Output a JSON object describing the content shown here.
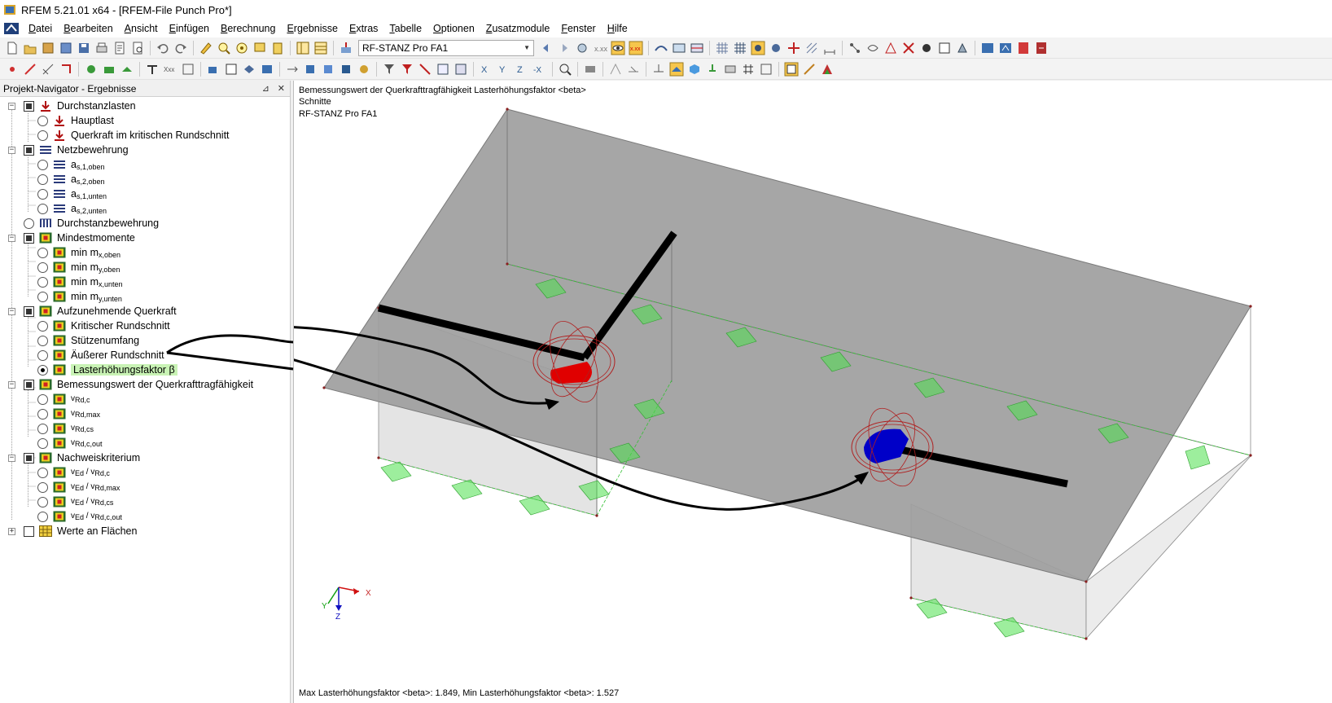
{
  "window": {
    "title": "RFEM 5.21.01 x64 - [RFEM-File Punch Pro*]"
  },
  "menu": [
    "Datei",
    "Bearbeiten",
    "Ansicht",
    "Einfügen",
    "Berechnung",
    "Ergebnisse",
    "Extras",
    "Tabelle",
    "Optionen",
    "Zusatzmodule",
    "Fenster",
    "Hilfe"
  ],
  "toolbar": {
    "load_case_combo": "RF-STANZ Pro FA1"
  },
  "navigator": {
    "title": "Projekt-Navigator - Ergebnisse",
    "groups": [
      {
        "label": "Durchstanzlasten",
        "items": [
          "Hauptlast",
          "Querkraft im kritischen Rundschnitt"
        ]
      },
      {
        "label": "Netzbewehrung",
        "items": [
          {
            "base": "a",
            "sub": "s,1,oben"
          },
          {
            "base": "a",
            "sub": "s,2,oben"
          },
          {
            "base": "a",
            "sub": "s,1,unten"
          },
          {
            "base": "a",
            "sub": "s,2,unten"
          }
        ]
      },
      {
        "label": "Durchstanzbewehrung",
        "items": []
      },
      {
        "label": "Mindestmomente",
        "items": [
          {
            "base": "min m",
            "sub": "x,oben"
          },
          {
            "base": "min m",
            "sub": "y,oben"
          },
          {
            "base": "min m",
            "sub": "x,unten"
          },
          {
            "base": "min m",
            "sub": "y,unten"
          }
        ]
      },
      {
        "label": "Aufzunehmende Querkraft",
        "items": [
          "Kritischer Rundschnitt",
          "Stützenumfang",
          "Äußerer Rundschnitt",
          "Lasterhöhungsfaktor β"
        ],
        "selected": "Lasterhöhungsfaktor β"
      },
      {
        "label": "Bemessungswert der Querkrafttragfähigkeit",
        "items": [
          {
            "base": "v",
            "sub": "Rd,c"
          },
          {
            "base": "v",
            "sub": "Rd,max"
          },
          {
            "base": "v",
            "sub": "Rd,cs"
          },
          {
            "base": "v",
            "sub": "Rd,c,out"
          }
        ]
      },
      {
        "label": "Nachweiskriterium",
        "items": [
          {
            "base": "v",
            "sub": "Ed",
            "base2": " / v",
            "sub2": "Rd,c"
          },
          {
            "base": "v",
            "sub": "Ed",
            "base2": " / v",
            "sub2": "Rd,max"
          },
          {
            "base": "v",
            "sub": "Ed",
            "base2": " / v",
            "sub2": "Rd,cs"
          },
          {
            "base": "v",
            "sub": "Ed",
            "base2": " / v",
            "sub2": "Rd,c,out"
          }
        ]
      },
      {
        "label": "Werte an Flächen",
        "items": []
      }
    ]
  },
  "viewport": {
    "info_line1": "Bemessungswert der Querkrafttragfähigkeit Lasterhöhungsfaktor <beta>",
    "info_line2": "Schnitte",
    "info_line3": "RF-STANZ Pro FA1",
    "status": "Max Lasterhöhungsfaktor <beta>: 1.849, Min Lasterhöhungsfaktor <beta>: 1.527",
    "axes": {
      "x": "X",
      "y": "Y",
      "z": "Z"
    }
  },
  "colors": {
    "max_marker": "#e00000",
    "min_marker": "#0000c8",
    "support": "#4ce04c",
    "slab": "#9e9e9e"
  }
}
